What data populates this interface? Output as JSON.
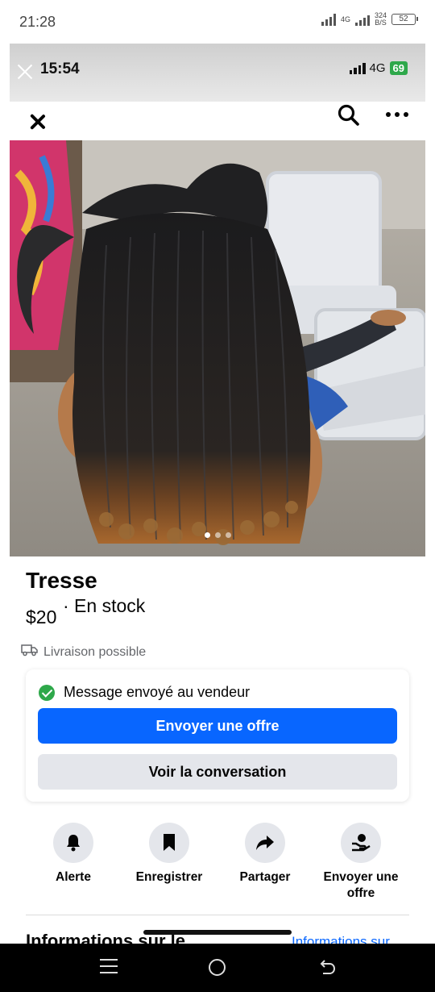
{
  "system_status": {
    "time": "21:28",
    "network": "4G",
    "speed_value": "324",
    "speed_unit": "B/S",
    "battery": "52"
  },
  "inner_status": {
    "time": "15:54",
    "network": "4G",
    "battery": "69"
  },
  "photo": {
    "dots": 3,
    "active_dot": 0
  },
  "listing": {
    "title": "Tresse",
    "price": "$20",
    "stock": "· En stock",
    "delivery": "Livraison possible"
  },
  "message_card": {
    "status": "Message envoyé au vendeur",
    "primary_button": "Envoyer une offre",
    "secondary_button": "Voir la conversation"
  },
  "actions": [
    {
      "label": "Alerte",
      "icon": "bell-icon"
    },
    {
      "label": "Enregistrer",
      "icon": "bookmark-icon"
    },
    {
      "label": "Partager",
      "icon": "share-icon"
    },
    {
      "label": "Envoyer une offre",
      "icon": "offer-icon"
    }
  ],
  "info_section": {
    "title": "Informations sur le",
    "link": "Informations sur"
  },
  "colors": {
    "primary": "#0866ff",
    "secondary_bg": "#e4e6eb",
    "success": "#2ea84a",
    "muted_text": "#65676b"
  }
}
